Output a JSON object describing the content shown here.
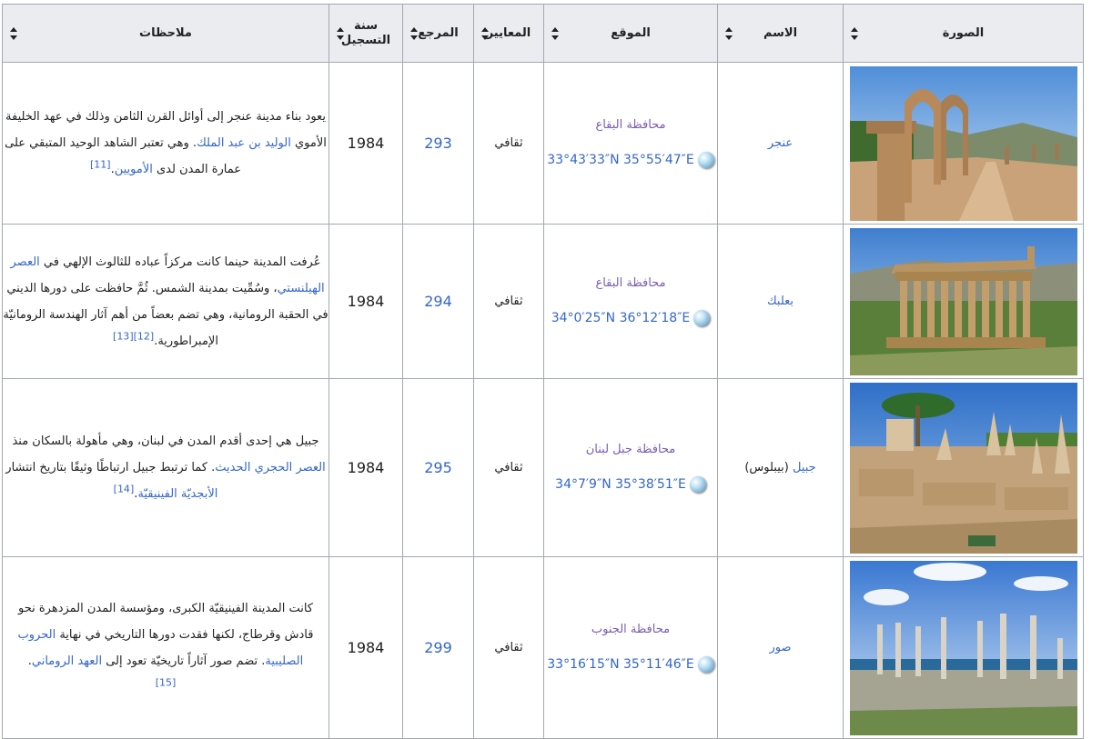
{
  "headers": {
    "image": "الصورة",
    "name": "الاسم",
    "location": "الموقع",
    "criteria": "المعايير",
    "reference": "المرجع",
    "year_line1": "سنة",
    "year_line2": "التسجيل",
    "notes": "ملاحظات"
  },
  "rows": [
    {
      "name": "عنجر",
      "name_extra": "",
      "region": "محافظة البقاع",
      "coords": "33°43′33″N 35°55′47″E",
      "criteria": "ثقافي",
      "ref": "293",
      "year": "1984",
      "notes": {
        "t1": "يعود بناء مدينة عنجر إلى أوائل القرن الثامن وذلك في عهد الخليفة الأموي ",
        "l1": "الوليد بن عبد الملك",
        "t2": ". وهي تعتبر الشاهد الوحيد المتبقي على عمارة المدن لدى ",
        "l2": "الأمويين",
        "t3": ".",
        "cite": "[11]"
      }
    },
    {
      "name": "بعلبك",
      "name_extra": "",
      "region": "محافظة البقاع",
      "coords": "34°0′25″N 36°12′18″E",
      "criteria": "ثقافي",
      "ref": "294",
      "year": "1984",
      "notes": {
        "t1": "عُرفت المدينة حينما كانت مركزاً عباده للثالوث الإلهي في ",
        "l1": "العصر الهيلنستي",
        "t2": "، وسُمِّيت بمدينة الشمس. ثُمَّ حافظت على دورها الديني في الحقبة الرومانية، وهي تضم بعضاً من أهم آثار الهندسة الرومانيّة الإمبراطورية.",
        "l2": "",
        "t3": "",
        "cite": "[12][13]"
      }
    },
    {
      "name": "جبيل",
      "name_extra": "(بيبلوس)",
      "region": "محافظة جبل لبنان",
      "coords": "34°7′9″N 35°38′51″E",
      "criteria": "ثقافي",
      "ref": "295",
      "year": "1984",
      "notes": {
        "t1": "جبيل هي إحدى أقدم المدن في لبنان، وهي مأهولة بالسكان منذ ",
        "l1": "العصر الحجري الحديث",
        "t2": ". كما ترتبط جبيل ارتباطًا وثيقًا بتاريخ انتشار ",
        "l2": "الأبجديّة الفينيقيّة",
        "t3": ".",
        "cite": "[14]"
      }
    },
    {
      "name": "صور",
      "name_extra": "",
      "region": "محافظة الجنوب",
      "coords": "33°16′15″N 35°11′46″E",
      "criteria": "ثقافي",
      "ref": "299",
      "year": "1984",
      "notes": {
        "t1": "كانت المدينة الفينيقيّة الكبرى، ومؤسسة المدن المزدهرة نحو قادش وقرطاج، لكنها فقدت دورها التاريخي في نهاية ",
        "l1": "الحروب الصليبية",
        "t2": ". تضم صور آثاراً تاريخيّة تعود إلى ",
        "l2": "العهد الروماني",
        "t3": ".",
        "cite": "[15]"
      }
    }
  ],
  "icons": {
    "sort": "sort-arrows-icon",
    "globe": "globe-icon"
  },
  "colors": {
    "link": "#3366cc",
    "visited_link": "#795cb2",
    "header_bg": "#eaecf0",
    "border": "#a2a9b1"
  }
}
